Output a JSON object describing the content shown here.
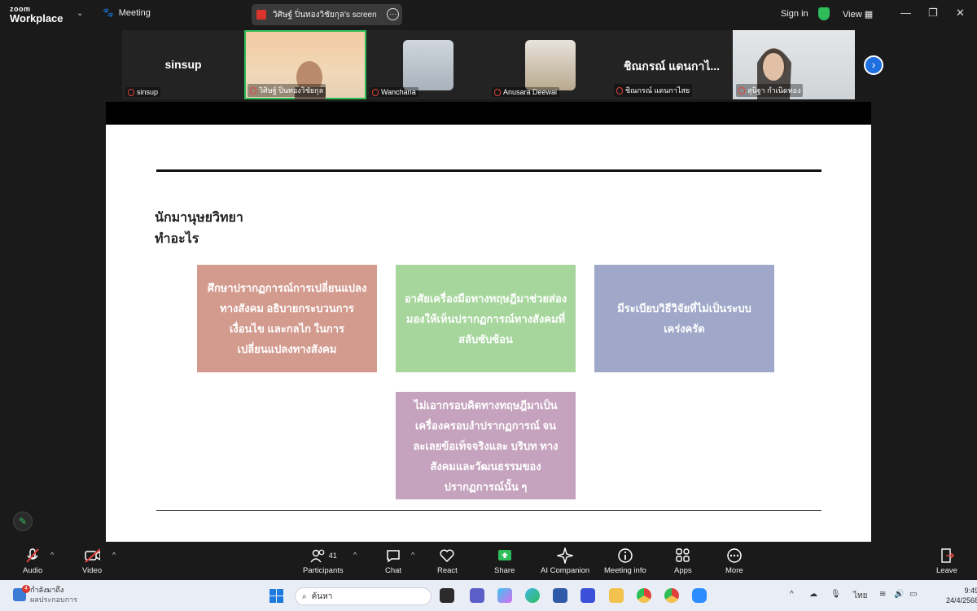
{
  "app": {
    "logo_line1": "zoom",
    "logo_line2": "Workplace",
    "meeting_label": "Meeting",
    "share_title": "วิศิษฐ์ ปิ่นทองวิชัยกุล's screen",
    "signin": "Sign in",
    "view": "View"
  },
  "participants_strip": [
    {
      "big_name": "sinsup",
      "label": "sinsup"
    },
    {
      "big_name": "",
      "label": "วิศิษฐ์ ปิ่นทองวิชัยกุล"
    },
    {
      "big_name": "",
      "label": "Wanchana"
    },
    {
      "big_name": "",
      "label": "Anusara Deewai"
    },
    {
      "big_name": "ชิณกรณ์ แดนกาไ...",
      "label": "ชิณกรณ์ แดนกาไสย"
    },
    {
      "big_name": "",
      "label": "สุนิฐา กำเนิดทอง"
    }
  ],
  "slide": {
    "heading_line1": "นักมานุษยวิทยา",
    "heading_line2": "ทำอะไร",
    "boxes": [
      {
        "text": "ศึกษาปรากฏการณ์การเปลี่ยนแปลงทางสังคม อธิบายกระบวนการ เงื่อนไข และกลไก ในการเปลี่ยนแปลงทางสังคม",
        "color": "#d39a8e"
      },
      {
        "text": "อาศัยเครื่องมือทางทฤษฎีมาช่วยส่องมองให้เห็นปรากฏการณ์ทางสังคมที่สลับซับซ้อน",
        "color": "#a6d69c"
      },
      {
        "text": "มีระเบียบวิธีวิจัยที่ไม่เป็นระบบเคร่งครัด",
        "color": "#9fa8c9"
      },
      {
        "text": "ไม่เอากรอบคิดทางทฤษฎีมาเป็นเครื่องครอบงำปรากฏการณ์ จนละเลยข้อเท็จจริงและ บริบท ทางสังคมและวัฒนธรรมของปรากฏการณ์นั้น ๆ",
        "color": "#c5a2bd"
      }
    ]
  },
  "toolbar": {
    "audio": "Audio",
    "video": "Video",
    "participants": "Participants",
    "participants_count": "41",
    "chat": "Chat",
    "react": "React",
    "share": "Share",
    "ai_companion": "AI Companion",
    "meeting_info": "Meeting info",
    "apps": "Apps",
    "more": "More",
    "leave": "Leave"
  },
  "taskbar": {
    "notif_badge": "4",
    "notif_line1": "กำลังมาถึง",
    "notif_line2": "ผลประกอบการ",
    "search_placeholder": "ค้นหา",
    "lang": "ไทย",
    "time": "9:49",
    "date": "24/4/2568"
  }
}
